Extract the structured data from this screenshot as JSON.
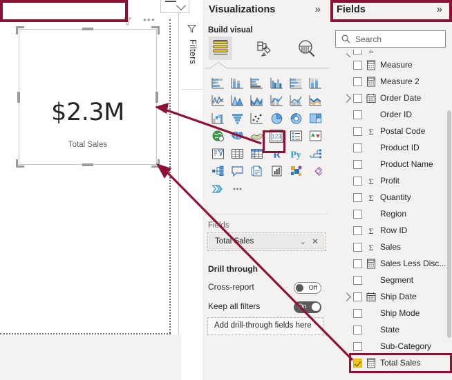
{
  "canvas": {
    "visual": {
      "value": "$2.3M",
      "label": "Total Sales",
      "header_filter_icon": "funnel-icon",
      "header_more_icon": "more-options-icon"
    },
    "topbar_collapse_icon": "chevron-down-icon"
  },
  "filters_rail": {
    "label": "Filters",
    "icon": "filter-funnel-icon"
  },
  "visualizations": {
    "title": "Visualizations",
    "collapse_icon": "chevrons-right-icon",
    "build_visual_label": "Build visual",
    "tabs": [
      {
        "name": "build-visual-tab",
        "icon": "fields-table-icon",
        "selected": true
      },
      {
        "name": "format-visual-tab",
        "icon": "paint-roller-icon",
        "selected": false
      },
      {
        "name": "analytics-tab",
        "icon": "magnifier-chart-icon",
        "selected": false
      }
    ],
    "selected_chart_type": "card-123-icon",
    "icon_grid": [
      [
        "stacked-bar-chart-icon",
        "stacked-column-chart-icon",
        "clustered-bar-chart-icon",
        "clustered-column-chart-icon",
        "hundred-percent-stacked-bar-icon",
        "hundred-percent-stacked-column-icon"
      ],
      [
        "line-chart-icon",
        "area-chart-icon",
        "stacked-area-chart-icon",
        "line-stacked-column-icon",
        "line-clustered-column-icon",
        "ribbon-chart-icon"
      ],
      [
        "waterfall-chart-icon",
        "funnel-chart-icon",
        "scatter-chart-icon",
        "pie-chart-icon",
        "donut-chart-icon",
        "treemap-icon"
      ],
      [
        "map-icon",
        "filled-map-icon",
        "shape-map-icon",
        "card-123-icon",
        "multi-row-card-icon",
        "kpi-icon"
      ],
      [
        "slicer-icon",
        "table-icon",
        "matrix-icon",
        "r-script-visual-icon",
        "python-visual-icon",
        "decomposition-tree-icon"
      ],
      [
        "key-influencers-icon",
        "smart-narrative-icon",
        "paginated-report-icon",
        "power-apps-icon",
        "power-automate-icon",
        "arcgis-maps-icon"
      ],
      [
        "azure-map-icon",
        "more-visuals-icon"
      ]
    ],
    "fields_well": {
      "label": "Fields",
      "chip": {
        "name": "Total Sales",
        "dropdown_icon": "chevron-down-icon",
        "remove_icon": "close-x-icon"
      }
    },
    "drill_through": {
      "title": "Drill through",
      "rows": [
        {
          "label": "Cross-report",
          "toggle_state": "Off",
          "on": false
        },
        {
          "label": "Keep all filters",
          "toggle_state": "On",
          "on": true
        }
      ],
      "dropzone_label": "Add drill-through fields here"
    }
  },
  "fields": {
    "title": "Fields",
    "collapse_icon": "chevrons-right-icon",
    "search": {
      "placeholder": "Search",
      "icon": "search-icon",
      "value": ""
    },
    "items": [
      {
        "label": "",
        "icon": "sigma-icon",
        "checked": false,
        "expandable": true,
        "partial": true
      },
      {
        "label": "Measure",
        "icon": "measure-icon",
        "checked": false,
        "expandable": false,
        "partial": false
      },
      {
        "label": "Measure 2",
        "icon": "measure-icon",
        "checked": false,
        "expandable": false,
        "partial": false
      },
      {
        "label": "Order Date",
        "icon": "calendar-icon",
        "checked": false,
        "expandable": true,
        "partial": false
      },
      {
        "label": "Order ID",
        "icon": "none",
        "checked": false,
        "expandable": false,
        "partial": false
      },
      {
        "label": "Postal Code",
        "icon": "sigma-icon",
        "checked": false,
        "expandable": false,
        "partial": false
      },
      {
        "label": "Product ID",
        "icon": "none",
        "checked": false,
        "expandable": false,
        "partial": false
      },
      {
        "label": "Product Name",
        "icon": "none",
        "checked": false,
        "expandable": false,
        "partial": false
      },
      {
        "label": "Profit",
        "icon": "sigma-icon",
        "checked": false,
        "expandable": false,
        "partial": false
      },
      {
        "label": "Quantity",
        "icon": "sigma-icon",
        "checked": false,
        "expandable": false,
        "partial": false
      },
      {
        "label": "Region",
        "icon": "none",
        "checked": false,
        "expandable": false,
        "partial": false
      },
      {
        "label": "Row ID",
        "icon": "sigma-icon",
        "checked": false,
        "expandable": false,
        "partial": false
      },
      {
        "label": "Sales",
        "icon": "sigma-icon",
        "checked": false,
        "expandable": false,
        "partial": false
      },
      {
        "label": "Sales Less Disc...",
        "icon": "measure-icon",
        "checked": false,
        "expandable": false,
        "partial": false
      },
      {
        "label": "Segment",
        "icon": "none",
        "checked": false,
        "expandable": false,
        "partial": false
      },
      {
        "label": "Ship Date",
        "icon": "calendar-icon",
        "checked": false,
        "expandable": true,
        "partial": false
      },
      {
        "label": "Ship Mode",
        "icon": "none",
        "checked": false,
        "expandable": false,
        "partial": false
      },
      {
        "label": "State",
        "icon": "none",
        "checked": false,
        "expandable": false,
        "partial": false
      },
      {
        "label": "Sub-Category",
        "icon": "none",
        "checked": false,
        "expandable": false,
        "partial": false
      },
      {
        "label": "Total Sales",
        "icon": "measure-icon",
        "checked": true,
        "expandable": false,
        "partial": false
      }
    ]
  },
  "annotations": {
    "highlight_color": "#8c1134",
    "boxes": [
      {
        "name": "visualizations-title-highlight"
      },
      {
        "name": "fields-title-highlight"
      },
      {
        "name": "card-visual-type-highlight"
      },
      {
        "name": "total-sales-field-highlight"
      }
    ],
    "arrows": [
      {
        "name": "arrow-card-icon-to-visual"
      },
      {
        "name": "arrow-total-sales-to-visual"
      }
    ]
  }
}
